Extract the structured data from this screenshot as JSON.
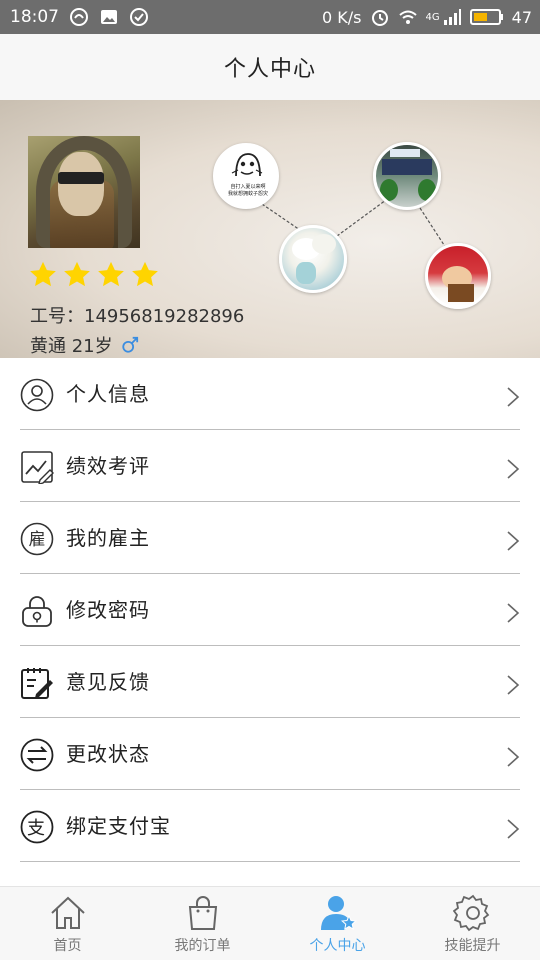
{
  "status_bar": {
    "time": "18:07",
    "network_speed": "0 K/s",
    "network_type": "4G",
    "battery": "47",
    "icons": [
      "circle-app-icon",
      "image-notification-icon",
      "check-circle-icon",
      "alarm-icon",
      "wifi-icon",
      "signal-icon",
      "battery-icon"
    ]
  },
  "header": {
    "title": "个人中心"
  },
  "profile": {
    "employee_id_label": "工号：",
    "employee_id": "14956819282896",
    "name_age": "黄通 21岁",
    "gender": "male",
    "rating": 4,
    "bubble_1_text_line1": "自打入夏以来啊",
    "bubble_1_text_line2": "我就想拥蚊子怨灾",
    "star_color": "#ffd400"
  },
  "menu": {
    "items": [
      {
        "label": "个人信息",
        "icon": "user-icon"
      },
      {
        "label": "绩效考评",
        "icon": "chart-icon"
      },
      {
        "label": "我的雇主",
        "icon": "employer-icon"
      },
      {
        "label": "修改密码",
        "icon": "lock-icon"
      },
      {
        "label": "意见反馈",
        "icon": "feedback-icon"
      },
      {
        "label": "更改状态",
        "icon": "switch-icon"
      },
      {
        "label": "绑定支付宝",
        "icon": "alipay-icon"
      }
    ]
  },
  "nav": {
    "items": [
      {
        "label": "首页",
        "icon": "home-icon",
        "active": false
      },
      {
        "label": "我的订单",
        "icon": "bag-icon",
        "active": false
      },
      {
        "label": "个人中心",
        "icon": "user-star-icon",
        "active": true
      },
      {
        "label": "技能提升",
        "icon": "gear-icon",
        "active": false
      }
    ],
    "active_color": "#4aa3e8"
  }
}
